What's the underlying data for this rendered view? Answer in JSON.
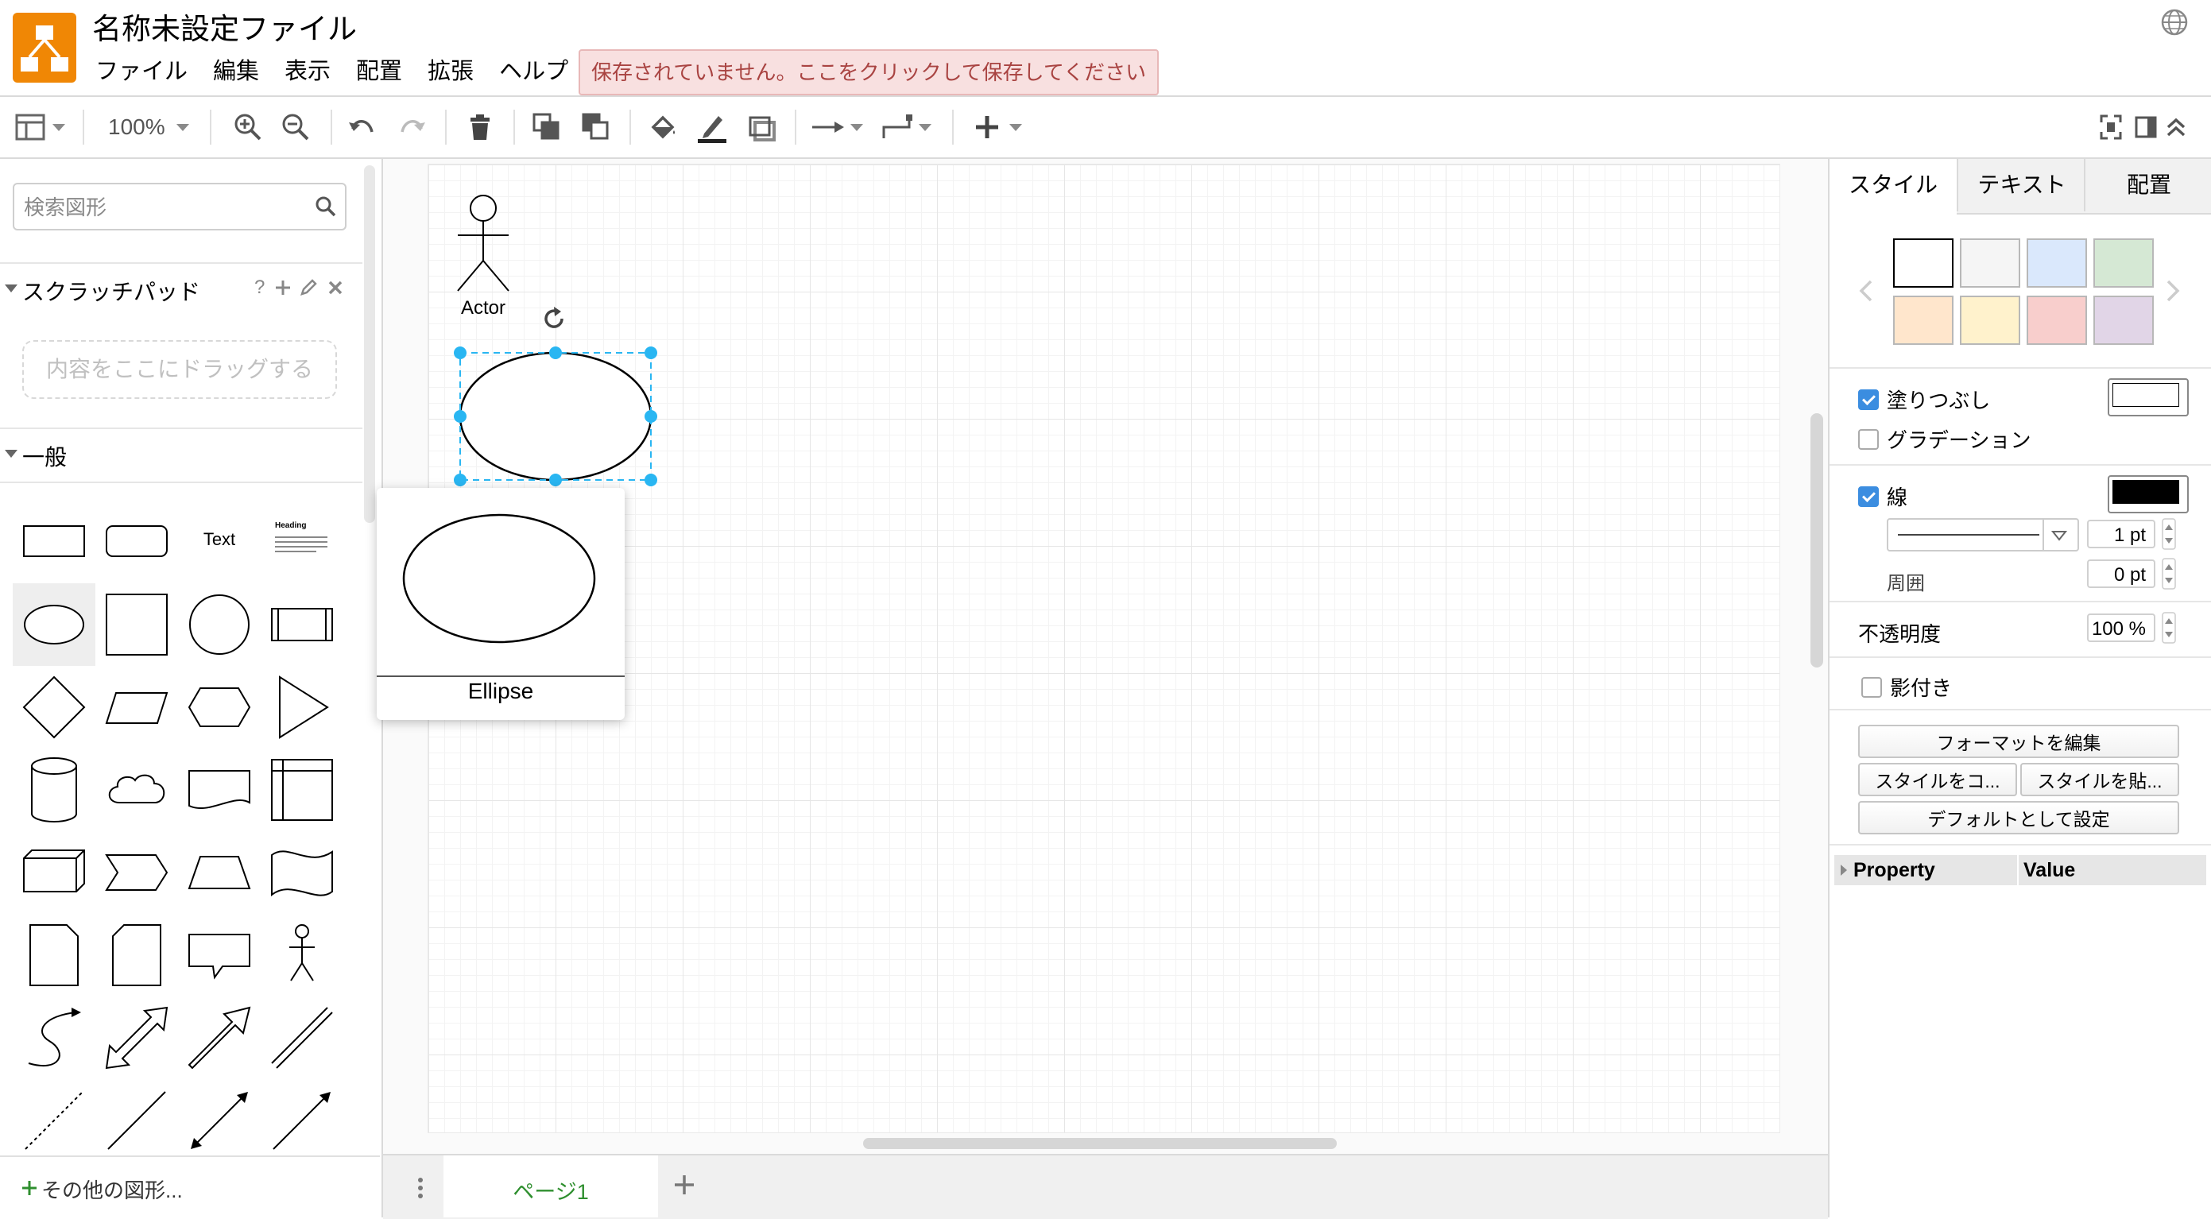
{
  "header": {
    "title": "名称未設定ファイル",
    "menus": [
      "ファイル",
      "編集",
      "表示",
      "配置",
      "拡張",
      "ヘルプ"
    ],
    "save_banner": "保存されていません。ここをクリックして保存してください"
  },
  "toolbar": {
    "zoom": "100%"
  },
  "sidebar": {
    "search_placeholder": "検索図形",
    "scratchpad_title": "スクラッチパッド",
    "scratchpad_help": "?",
    "drop_zone": "内容をここにドラッグする",
    "general_title": "一般",
    "text_shape_label": "Text",
    "heading_shape_label": "Heading",
    "more_shapes": "その他の図形..."
  },
  "canvas": {
    "actor_label": "Actor",
    "preview_label": "Ellipse"
  },
  "pages": {
    "tab1": "ページ1"
  },
  "format_panel": {
    "tabs": [
      "スタイル",
      "テキスト",
      "配置"
    ],
    "fill_label": "塗りつぶし",
    "gradient_label": "グラデーション",
    "line_label": "線",
    "line_width": "1 pt",
    "perimeter_label": "周囲",
    "perimeter_value": "0 pt",
    "opacity_label": "不透明度",
    "opacity_value": "100 %",
    "shadow_label": "影付き",
    "edit_style_button": "フォーマットを編集",
    "copy_style_button": "スタイルをコ...",
    "paste_style_button": "スタイルを貼...",
    "set_default_button": "デフォルトとして設定",
    "property_header": "Property",
    "value_header": "Value",
    "swatch_colors": [
      "#ffffff",
      "#f5f5f5",
      "#dae8fc",
      "#d5e8d4",
      "#ffe6cc",
      "#fff2cc",
      "#f8cecc",
      "#e1d5e7"
    ]
  },
  "colors": {
    "brand_orange": "#f08705",
    "selection_blue": "#29b6f2",
    "page_tab_green": "#2f8f2f",
    "banner_text": "#a94442"
  }
}
